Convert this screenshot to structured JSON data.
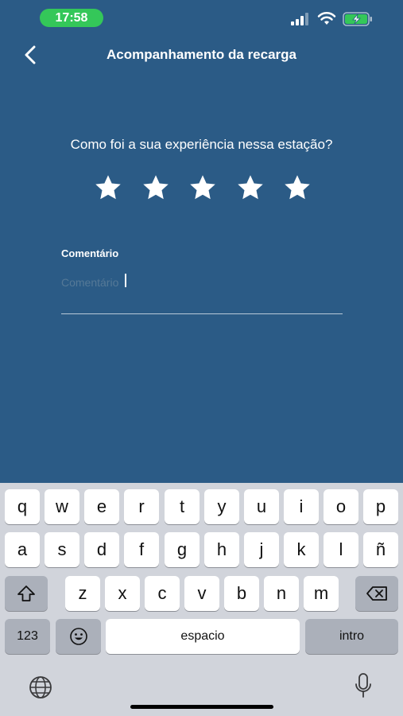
{
  "status_bar": {
    "time": "17:58",
    "time_pill_color": "#34c759"
  },
  "nav": {
    "back_icon": "chevron-left-icon",
    "title": "Acompanhamento da recarga"
  },
  "rating": {
    "question": "Como foi a sua experiência nessa estação?",
    "max_stars": 5,
    "selected_stars": 5
  },
  "comment": {
    "label": "Comentário",
    "value": "",
    "placeholder": "Comentário"
  },
  "keyboard": {
    "row1": [
      "q",
      "w",
      "e",
      "r",
      "t",
      "y",
      "u",
      "i",
      "o",
      "p"
    ],
    "row2": [
      "a",
      "s",
      "d",
      "f",
      "g",
      "h",
      "j",
      "k",
      "l",
      "ñ"
    ],
    "row3": [
      "z",
      "x",
      "c",
      "v",
      "b",
      "n",
      "m"
    ],
    "numbers_label": "123",
    "space_label": "espacio",
    "return_label": "intro",
    "shift_icon": "shift-icon",
    "delete_icon": "backspace-icon",
    "emoji_icon": "emoji-icon",
    "globe_icon": "globe-icon",
    "mic_icon": "microphone-icon"
  },
  "colors": {
    "background": "#2b5b86",
    "keyboard_bg": "#d1d4db"
  }
}
